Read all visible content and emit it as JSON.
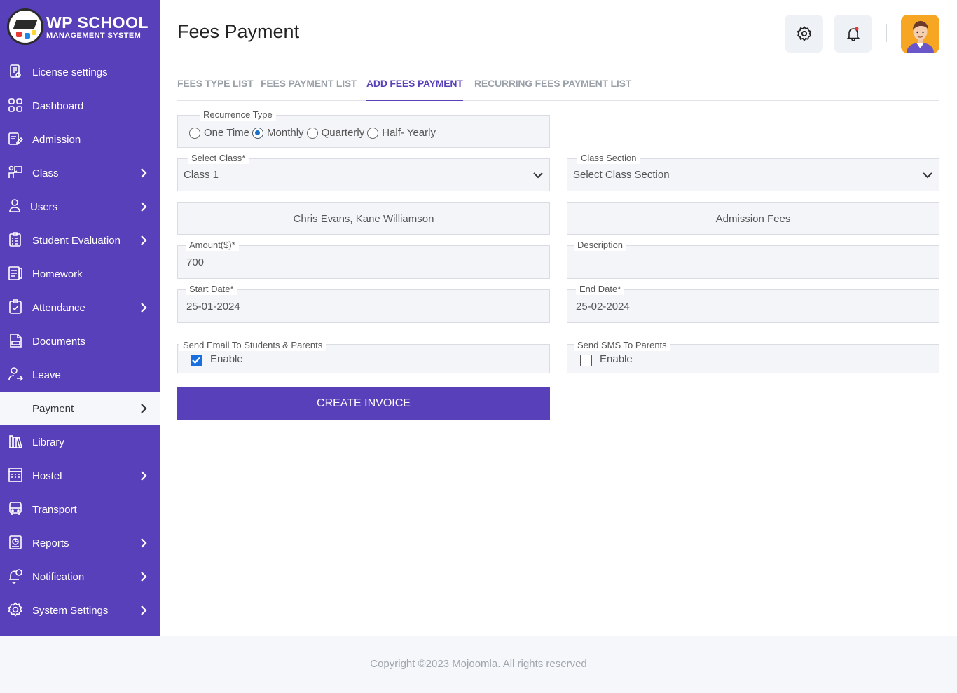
{
  "brand": {
    "title": "WP SCHOOL",
    "subtitle": "MANAGEMENT SYSTEM"
  },
  "sidebar": {
    "items": [
      {
        "label": "License settings",
        "icon": "license-icon",
        "chevron": false
      },
      {
        "label": "Dashboard",
        "icon": "dashboard-icon",
        "chevron": false
      },
      {
        "label": "Admission",
        "icon": "admission-icon",
        "chevron": false
      },
      {
        "label": "Class",
        "icon": "class-icon",
        "chevron": true
      },
      {
        "label": "Users",
        "icon": "users-icon",
        "chevron": true
      },
      {
        "label": "Student Evaluation",
        "icon": "evaluation-icon",
        "chevron": true
      },
      {
        "label": "Homework",
        "icon": "homework-icon",
        "chevron": false
      },
      {
        "label": "Attendance",
        "icon": "attendance-icon",
        "chevron": true
      },
      {
        "label": "Documents",
        "icon": "documents-icon",
        "chevron": false
      },
      {
        "label": "Leave",
        "icon": "leave-icon",
        "chevron": false
      },
      {
        "label": "Payment",
        "icon": "payment-icon",
        "chevron": true,
        "active": true
      },
      {
        "label": "Library",
        "icon": "library-icon",
        "chevron": false
      },
      {
        "label": "Hostel",
        "icon": "hostel-icon",
        "chevron": true
      },
      {
        "label": "Transport",
        "icon": "transport-icon",
        "chevron": false
      },
      {
        "label": "Reports",
        "icon": "reports-icon",
        "chevron": true
      },
      {
        "label": "Notification",
        "icon": "notification-icon",
        "chevron": true
      },
      {
        "label": "System Settings",
        "icon": "settings-icon",
        "chevron": true
      }
    ]
  },
  "header": {
    "title": "Fees Payment"
  },
  "tabs": [
    {
      "label": "FEES TYPE LIST"
    },
    {
      "label": "FEES PAYMENT LIST"
    },
    {
      "label": "ADD FEES PAYMENT",
      "active": true
    },
    {
      "label": "RECURRING FEES PAYMENT LIST"
    }
  ],
  "form": {
    "recurrence": {
      "label": "Recurrence Type",
      "options": [
        "One Time",
        "Monthly",
        "Quarterly",
        "Half- Yearly"
      ],
      "selected": "Monthly"
    },
    "select_class": {
      "label": "Select Class*",
      "value": "Class 1"
    },
    "class_section": {
      "label": "Class Section",
      "value": "Select Class Section"
    },
    "students": {
      "value": "Chris Evans, Kane Williamson"
    },
    "fees_type": {
      "value": "Admission Fees"
    },
    "amount": {
      "label": "Amount($)*",
      "value": "700"
    },
    "description": {
      "label": "Description",
      "value": ""
    },
    "start_date": {
      "label": "Start Date*",
      "value": "25-01-2024"
    },
    "end_date": {
      "label": "End Date*",
      "value": "25-02-2024"
    },
    "send_email": {
      "label": "Send Email To Students & Parents",
      "option": "Enable",
      "checked": true
    },
    "send_sms": {
      "label": "Send SMS To Parents",
      "option": "Enable",
      "checked": false
    },
    "submit_label": "CREATE INVOICE"
  },
  "footer": {
    "text": "Copyright ©2023 Mojoomla. All rights reserved"
  },
  "colors": {
    "primary": "#5840bb",
    "checkbox": "#1a6fe0",
    "notification_dot": "#e53935",
    "avatar_bg": "#f6a623"
  }
}
